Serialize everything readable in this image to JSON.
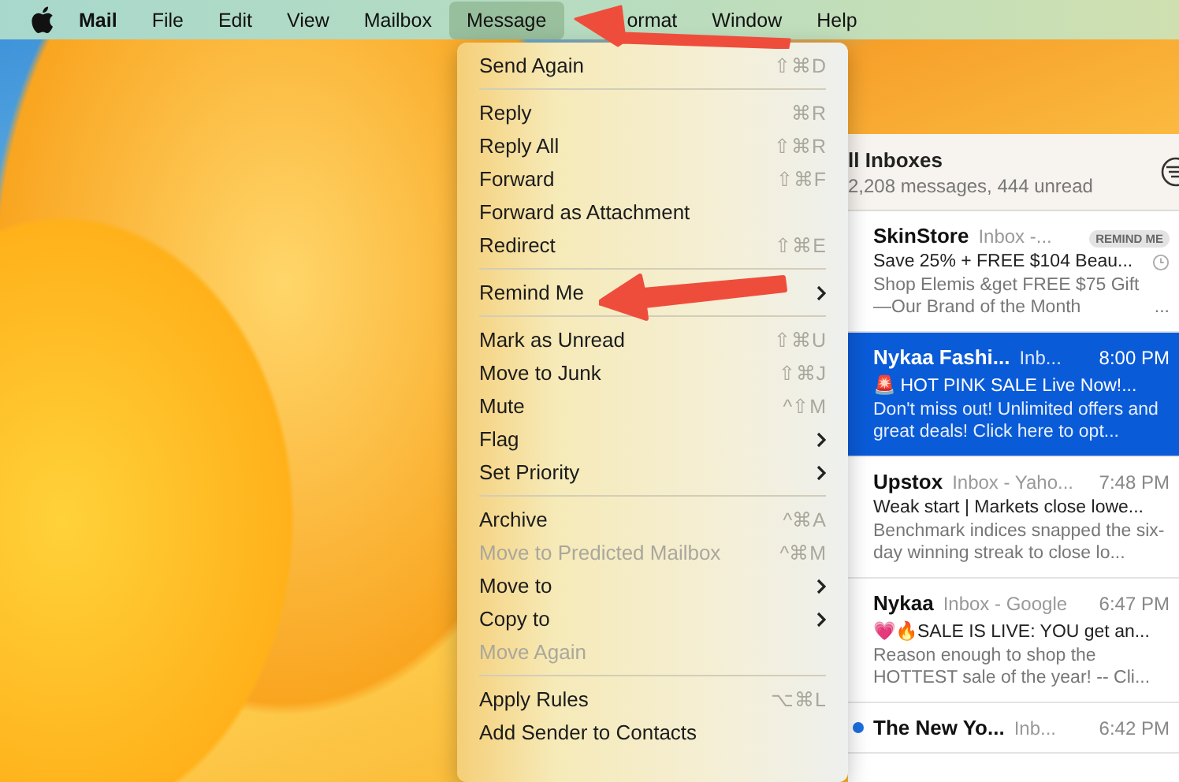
{
  "menu_bar": [
    {
      "label": "Mail",
      "selected": false,
      "bold": true
    },
    {
      "label": "File",
      "selected": false
    },
    {
      "label": "Edit",
      "selected": false
    },
    {
      "label": "View",
      "selected": false
    },
    {
      "label": "Mailbox",
      "selected": false
    },
    {
      "label": "Message",
      "selected": true
    },
    {
      "label": "ormat",
      "selected": false
    },
    {
      "label": "Window",
      "selected": false
    },
    {
      "label": "Help",
      "selected": false
    }
  ],
  "menu": [
    {
      "kind": "item",
      "label": "Send Again",
      "shortcut": "⇧⌘D",
      "disabled": false
    },
    {
      "kind": "separator"
    },
    {
      "kind": "item",
      "label": "Reply",
      "shortcut": "⌘R",
      "disabled": false
    },
    {
      "kind": "item",
      "label": "Reply All",
      "shortcut": "⇧⌘R",
      "disabled": false
    },
    {
      "kind": "item",
      "label": "Forward",
      "shortcut": "⇧⌘F",
      "disabled": false
    },
    {
      "kind": "item",
      "label": "Forward as Attachment",
      "disabled": false
    },
    {
      "kind": "item",
      "label": "Redirect",
      "shortcut": "⇧⌘E",
      "disabled": false
    },
    {
      "kind": "separator"
    },
    {
      "kind": "submenu",
      "label": "Remind Me",
      "disabled": false
    },
    {
      "kind": "separator"
    },
    {
      "kind": "item",
      "label": "Mark as Unread",
      "shortcut": "⇧⌘U",
      "disabled": false
    },
    {
      "kind": "item",
      "label": "Move to Junk",
      "shortcut": "⇧⌘J",
      "disabled": false
    },
    {
      "kind": "item",
      "label": "Mute",
      "shortcut": "^⇧M",
      "disabled": false
    },
    {
      "kind": "submenu",
      "label": "Flag",
      "disabled": false
    },
    {
      "kind": "submenu",
      "label": "Set Priority",
      "disabled": false
    },
    {
      "kind": "separator"
    },
    {
      "kind": "item",
      "label": "Archive",
      "shortcut": "^⌘A",
      "disabled": false
    },
    {
      "kind": "item",
      "label": "Move to Predicted Mailbox",
      "shortcut": "^⌘M",
      "disabled": true
    },
    {
      "kind": "submenu",
      "label": "Move to",
      "disabled": false
    },
    {
      "kind": "submenu",
      "label": "Copy to",
      "disabled": false
    },
    {
      "kind": "item",
      "label": "Move Again",
      "disabled": true
    },
    {
      "kind": "separator"
    },
    {
      "kind": "item",
      "label": "Apply Rules",
      "shortcut": "⌥⌘L",
      "disabled": false
    },
    {
      "kind": "item",
      "label": "Add Sender to Contacts",
      "disabled": false
    }
  ],
  "mailbox": {
    "title": "ll Inboxes",
    "subtitle": "2,208 messages, 444 unread"
  },
  "messages": [
    {
      "sender": "SkinStore",
      "mailbox": "Inbox -...",
      "badge": "REMIND ME",
      "subject": "Save 25% + FREE $104 Beau...",
      "preview": "Shop Elemis &get FREE $75 Gift—Our Brand of the Month",
      "more": "...",
      "snoozed": true,
      "selected": false,
      "unread": false
    },
    {
      "sender": "Nykaa Fashi...",
      "mailbox": "Inb...",
      "time": "8:00 PM",
      "subject": "🚨 HOT PINK SALE Live Now!...",
      "preview": "Don't miss out! Unlimited offers and great deals! Click here to opt...",
      "selected": true,
      "unread": false
    },
    {
      "sender": "Upstox",
      "mailbox": "Inbox - Yaho...",
      "time": "7:48 PM",
      "subject": "Weak start | Markets close lowe...",
      "preview": "Benchmark indices snapped the six-day winning streak to close lo...",
      "selected": false,
      "unread": false
    },
    {
      "sender": "Nykaa",
      "mailbox": "Inbox - Google",
      "time": "6:47 PM",
      "subject": "💗🔥SALE IS LIVE: YOU get an...",
      "preview": "Reason enough to shop the HOTTEST sale of the year! -- Cli...",
      "selected": false,
      "unread": false
    },
    {
      "sender": "The New Yo...",
      "mailbox": "Inb...",
      "time": "6:42 PM",
      "selected": false,
      "unread": true
    }
  ]
}
